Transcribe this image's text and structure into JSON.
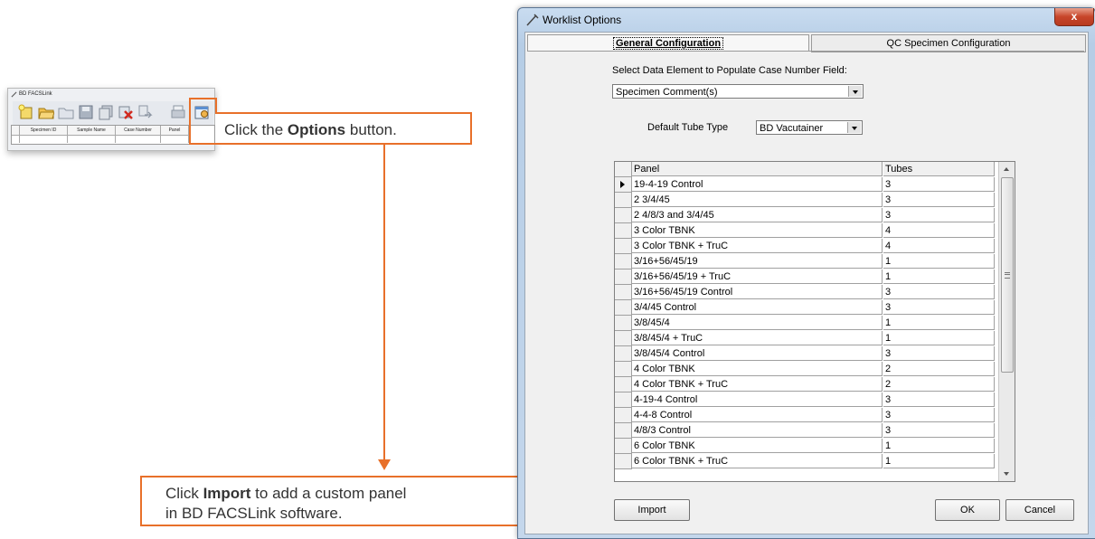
{
  "mini_window": {
    "title": "BD FACSLink",
    "toolbar_icons": [
      "new-icon",
      "open-folder-icon",
      "folder-icon",
      "save-icon",
      "copy-icon",
      "delete-icon",
      "export-icon",
      "print-icon",
      "options-icon"
    ],
    "columns": [
      "Specimen ID",
      "Sample Name",
      "Case Number",
      "Panel"
    ]
  },
  "callouts": {
    "options": {
      "prefix": "Click the ",
      "bold": "Options",
      "suffix": " button."
    },
    "import": {
      "prefix": "Click ",
      "bold": "Import",
      "suffix": " to add a custom panel",
      "line2": "in BD FACSLink software."
    }
  },
  "dialog": {
    "title": "Worklist Options",
    "close_label": "x",
    "tabs": [
      "General Configuration",
      "QC Specimen Configuration"
    ],
    "case_label": "Select Data Element to Populate Case Number Field:",
    "case_value": "Specimen Comment(s)",
    "tube_label": "Default Tube Type",
    "tube_value": "BD Vacutainer",
    "grid": {
      "headers": [
        "Panel",
        "Tubes"
      ],
      "rows": [
        {
          "panel": "19-4-19 Control",
          "tubes": "3"
        },
        {
          "panel": "2 3/4/45",
          "tubes": "3"
        },
        {
          "panel": "2 4/8/3 and 3/4/45",
          "tubes": "3"
        },
        {
          "panel": "3 Color TBNK",
          "tubes": "4"
        },
        {
          "panel": "3 Color TBNK + TruC",
          "tubes": "4"
        },
        {
          "panel": "3/16+56/45/19",
          "tubes": "1"
        },
        {
          "panel": "3/16+56/45/19 + TruC",
          "tubes": "1"
        },
        {
          "panel": "3/16+56/45/19 Control",
          "tubes": "3"
        },
        {
          "panel": "3/4/45 Control",
          "tubes": "3"
        },
        {
          "panel": "3/8/45/4",
          "tubes": "1"
        },
        {
          "panel": "3/8/45/4 + TruC",
          "tubes": "1"
        },
        {
          "panel": "3/8/45/4 Control",
          "tubes": "3"
        },
        {
          "panel": "4 Color TBNK",
          "tubes": "2"
        },
        {
          "panel": "4 Color TBNK + TruC",
          "tubes": "2"
        },
        {
          "panel": "4-19-4 Control",
          "tubes": "3"
        },
        {
          "panel": "4-4-8 Control",
          "tubes": "3"
        },
        {
          "panel": "4/8/3 Control",
          "tubes": "3"
        },
        {
          "panel": "6 Color TBNK",
          "tubes": "1"
        },
        {
          "panel": "6 Color TBNK + TruC",
          "tubes": "1"
        }
      ]
    },
    "buttons": {
      "import": "Import",
      "ok": "OK",
      "cancel": "Cancel"
    }
  },
  "colors": {
    "callout": "#e8702a",
    "titlebar": "#c4d7ec",
    "close": "#c7452a"
  }
}
